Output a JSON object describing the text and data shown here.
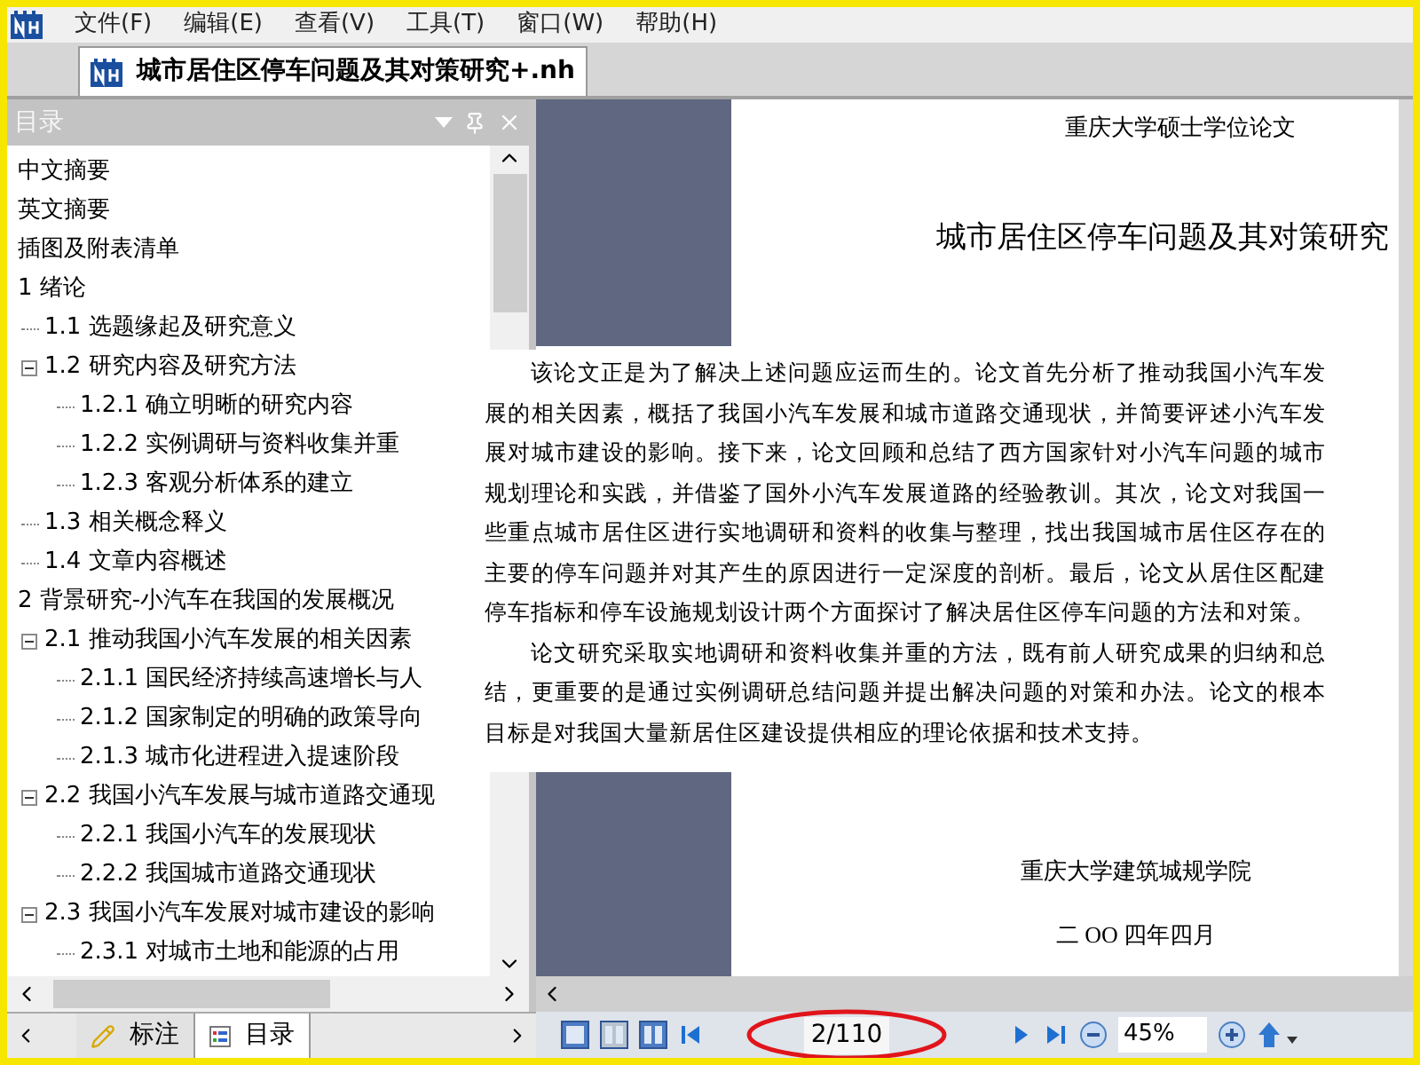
{
  "menu": [
    "文件(F)",
    "编辑(E)",
    "查看(V)",
    "工具(T)",
    "窗口(W)",
    "帮助(H)"
  ],
  "document_tab": {
    "title": "城市居住区停车问题及其对策研究+.nh"
  },
  "toc_panel": {
    "title": "目录",
    "items": [
      {
        "label": "中文摘要"
      },
      {
        "label": "英文摘要"
      },
      {
        "label": "插图及附表清单"
      },
      {
        "label": "1 绪论",
        "children": [
          {
            "label": "1.1 选题缘起及研究意义"
          },
          {
            "label": "1.2 研究内容及研究方法",
            "expanded": true,
            "children": [
              {
                "label": "1.2.1 确立明晰的研究内容"
              },
              {
                "label": "1.2.2 实例调研与资料收集并重"
              },
              {
                "label": "1.2.3 客观分析体系的建立"
              }
            ]
          },
          {
            "label": "1.3 相关概念释义"
          },
          {
            "label": "1.4 文章内容概述"
          }
        ]
      },
      {
        "label": "2 背景研究-小汽车在我国的发展概况",
        "children": [
          {
            "label": "2.1 推动我国小汽车发展的相关因素",
            "expanded": true,
            "children": [
              {
                "label": "2.1.1 国民经济持续高速增长与人"
              },
              {
                "label": "2.1.2 国家制定的明确的政策导向"
              },
              {
                "label": "2.1.3 城市化进程进入提速阶段"
              }
            ]
          },
          {
            "label": "2.2 我国小汽车发展与城市道路交通现",
            "expanded": true,
            "children": [
              {
                "label": "2.2.1 我国小汽车的发展现状"
              },
              {
                "label": "2.2.2 我国城市道路交通现状"
              }
            ]
          },
          {
            "label": "2.3 我国小汽车发展对城市建设的影响",
            "expanded": true,
            "children": [
              {
                "label": "2.3.1 对城市土地和能源的占用"
              }
            ]
          }
        ]
      }
    ]
  },
  "panel_tabs": [
    {
      "label": "标注",
      "selected": false
    },
    {
      "label": "目录",
      "selected": true
    }
  ],
  "page": {
    "header": "重庆大学硕士学位论文",
    "title": "城市居住区停车问题及其对策研究",
    "paragraphs": [
      "该论文正是为了解决上述问题应运而生的。论文首先分析了推动我国小汽车发展的相关因素，概括了我国小汽车发展和城市道路交通现状，并简要评述小汽车发展对城市建设的影响。接下来，论文回顾和总结了西方国家针对小汽车问题的城市规划理论和实践，并借鉴了国外小汽车发展道路的经验教训。其次，论文对我国一些重点城市居住区进行实地调研和资料的收集与整理，找出我国城市居住区存在的主要的停车问题并对其产生的原因进行一定深度的剖析。最后，论文从居住区配建停车指标和停车设施规划设计两个方面探讨了解决居住区停车问题的方法和对策。",
      "论文研究采取实地调研和资料收集并重的方法，既有前人研究成果的归纳和总结，更重要的是通过实例调研总结问题并提出解决问题的对策和办法。论文的根本目标是对我国大量新居住区建设提供相应的理论依据和技术支持。"
    ],
    "footer_school": "重庆大学建筑城规学院",
    "footer_date": "二 OO 四年四月"
  },
  "toolbar": {
    "page_number": "2/110",
    "zoom": "45%"
  }
}
